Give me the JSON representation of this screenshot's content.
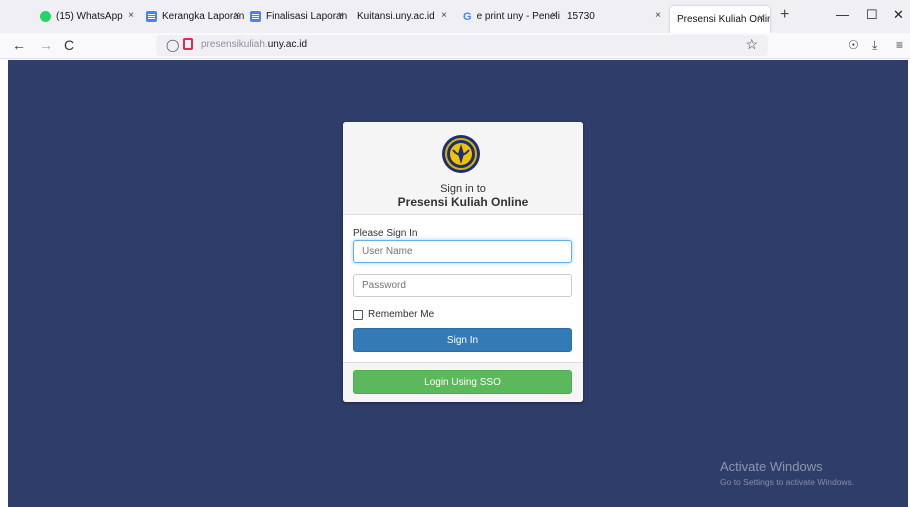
{
  "browser": {
    "tabs": [
      {
        "label": "(15) WhatsApp",
        "icon": "whatsapp-icon",
        "close": "×"
      },
      {
        "label": "Kerangka Laporan ⬚",
        "icon": "docs-icon",
        "close": "×"
      },
      {
        "label": "Finalisasi Laporan ⬚",
        "icon": "docs-icon",
        "close": "×"
      },
      {
        "label": "Kuitansi.uny.ac.id",
        "icon": "",
        "close": "×"
      },
      {
        "label": "e print uny - Peneli",
        "icon": "google-icon",
        "close": "×"
      },
      {
        "label": "15730",
        "icon": "",
        "close": "×"
      },
      {
        "label": "Presensi Kuliah Online",
        "icon": "",
        "close": "×"
      }
    ],
    "new_tab": "+",
    "window_controls": {
      "minimize": "—",
      "maximize": "☐",
      "close": "✕"
    },
    "nav": {
      "back": "←",
      "forward": "→",
      "reload": "C"
    },
    "url": {
      "subdomain": "presensikuliah.",
      "domain": "uny.ac.id"
    },
    "bookmark_star": "☆",
    "toolbar": {
      "pocket": "☉",
      "download": "⤓",
      "menu": "≡"
    }
  },
  "login": {
    "heading_small": "Sign in to",
    "heading_app": "Presensi Kuliah Online",
    "prompt": "Please Sign In",
    "username_placeholder": "User Name",
    "password_placeholder": "Password",
    "remember_label": "Remember Me",
    "signin_button": "Sign In",
    "sso_button": "Login Using SSO"
  },
  "watermark": {
    "title": "Activate Windows",
    "subtitle": "Go to Settings to activate Windows."
  },
  "colors": {
    "page_background": "#2f3d6b",
    "signin_button": "#337ab7",
    "sso_button": "#5cb85c"
  }
}
